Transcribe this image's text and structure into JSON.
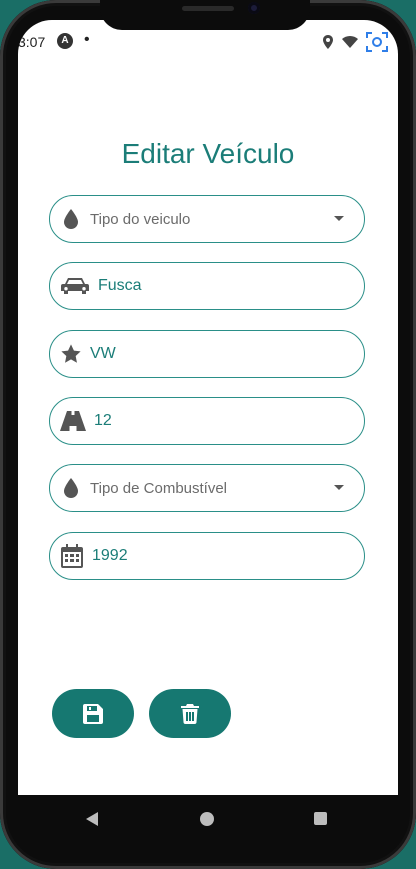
{
  "status_bar": {
    "time": "3:07",
    "badge": "A",
    "dot": "•"
  },
  "page": {
    "title": "Editar Veículo"
  },
  "fields": {
    "vehicle_type": {
      "placeholder": "Tipo do veiculo",
      "icon": "drop-icon"
    },
    "model": {
      "value": "Fusca",
      "icon": "car-icon"
    },
    "brand": {
      "value": "VW",
      "icon": "star-icon"
    },
    "mileage": {
      "value": "12",
      "icon": "road-icon"
    },
    "fuel_type": {
      "placeholder": "Tipo de Combustível",
      "icon": "drop-icon"
    },
    "year": {
      "value": "1992",
      "icon": "calendar-icon"
    }
  },
  "actions": {
    "save_icon": "save-icon",
    "delete_icon": "trash-icon"
  },
  "colors": {
    "accent": "#1b7d78",
    "button": "#167871"
  }
}
